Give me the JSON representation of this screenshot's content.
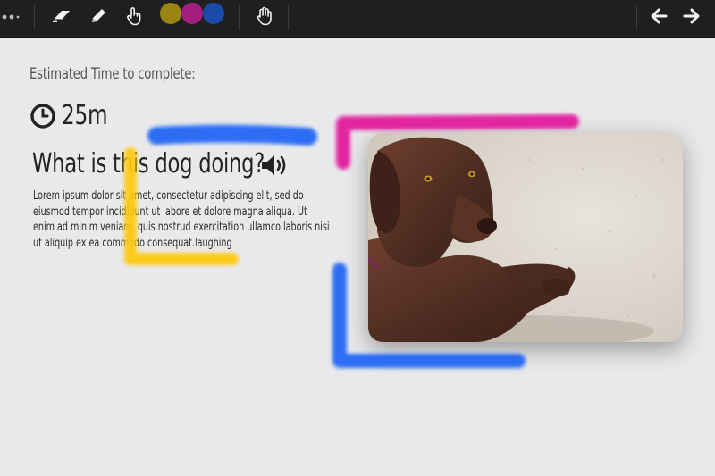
{
  "toolbar": {
    "tools": [
      {
        "name": "more-icon"
      },
      {
        "name": "eraser-icon"
      },
      {
        "name": "pencil-icon"
      },
      {
        "name": "pointer-hand-icon"
      },
      {
        "name": "grab-hand-icon"
      }
    ],
    "colors": [
      "#9a8414",
      "#a31f7e",
      "#1b4ba8"
    ],
    "nav": [
      {
        "name": "back-arrow-icon"
      },
      {
        "name": "forward-arrow-icon"
      }
    ]
  },
  "content": {
    "estimate_label": "Estimated Time to complete:",
    "time_value": "25m",
    "question": "What is this dog doing?",
    "body": "Lorem ipsum dolor sit amet, consectetur adipiscing elit, sed do eiusmod tempor incididunt ut labore et dolore magna aliqua. Ut enim ad minim veniam, quis nostrud exercitation ullamco laboris nisi ut aliquip ex ea commodo consequat.laughing"
  },
  "annotation_colors": {
    "blue": "#1e63f5",
    "yellow": "#ffc90e",
    "magenta": "#e2199b"
  }
}
